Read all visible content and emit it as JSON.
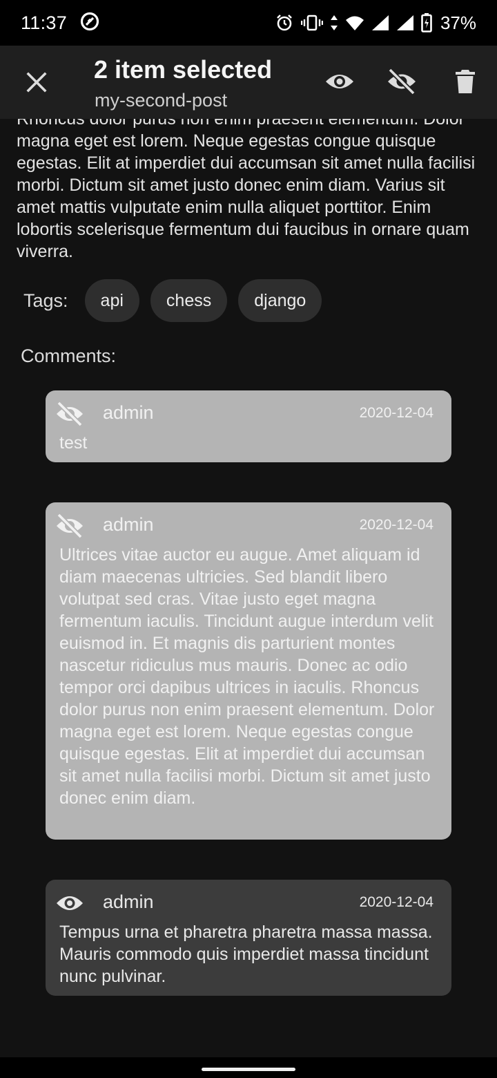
{
  "status_bar": {
    "time": "11:37",
    "battery": "37%"
  },
  "action_bar": {
    "title": "2 item selected",
    "subtitle": "my-second-post",
    "icons": [
      "close-icon",
      "eye-icon",
      "eye-off-icon",
      "trash-icon"
    ]
  },
  "post": {
    "body": "Rhoncus dolor purus non enim praesent elementum. Dolor magna eget est lorem. Neque egestas congue quisque egestas. Elit at imperdiet dui accumsan sit amet nulla facilisi morbi. Dictum sit amet justo donec enim diam. Varius sit amet mattis vulputate enim nulla aliquet porttitor. Enim lobortis scelerisque fermentum dui faucibus in ornare quam viverra."
  },
  "tags": {
    "label": "Tags:",
    "items": [
      "api",
      "chess",
      "django"
    ]
  },
  "comments": {
    "label": "Comments:",
    "items": [
      {
        "visibility_icon": "eye-off-icon",
        "author": "admin",
        "date": "2020-12-04",
        "text": "test",
        "selected": true
      },
      {
        "visibility_icon": "eye-off-icon",
        "author": "admin",
        "date": "2020-12-04",
        "text": "Ultrices vitae auctor eu augue. Amet aliquam id diam maecenas ultricies. Sed blandit libero volutpat sed cras. Vitae justo eget magna fermentum iaculis. Tincidunt augue interdum velit euismod in. Et magnis dis parturient montes nascetur ridiculus mus mauris. Donec ac odio tempor orci dapibus ultrices in iaculis. Rhoncus dolor purus non enim praesent elementum. Dolor magna eget est lorem. Neque egestas congue quisque egestas. Elit at imperdiet dui accumsan sit amet nulla facilisi morbi. Dictum sit amet justo donec enim diam.",
        "selected": true
      },
      {
        "visibility_icon": "eye-icon",
        "author": "admin",
        "date": "2020-12-04",
        "text": "Tempus urna et pharetra pharetra massa massa. Mauris commodo quis imperdiet massa tincidunt nunc pulvinar.",
        "selected": false
      }
    ]
  },
  "colors": {
    "background": "#121212",
    "action_bar": "#1f1f1f",
    "chip": "#2e2e2e",
    "comment_selected": "#b4b4b4",
    "comment_normal": "#3c3c3c"
  }
}
